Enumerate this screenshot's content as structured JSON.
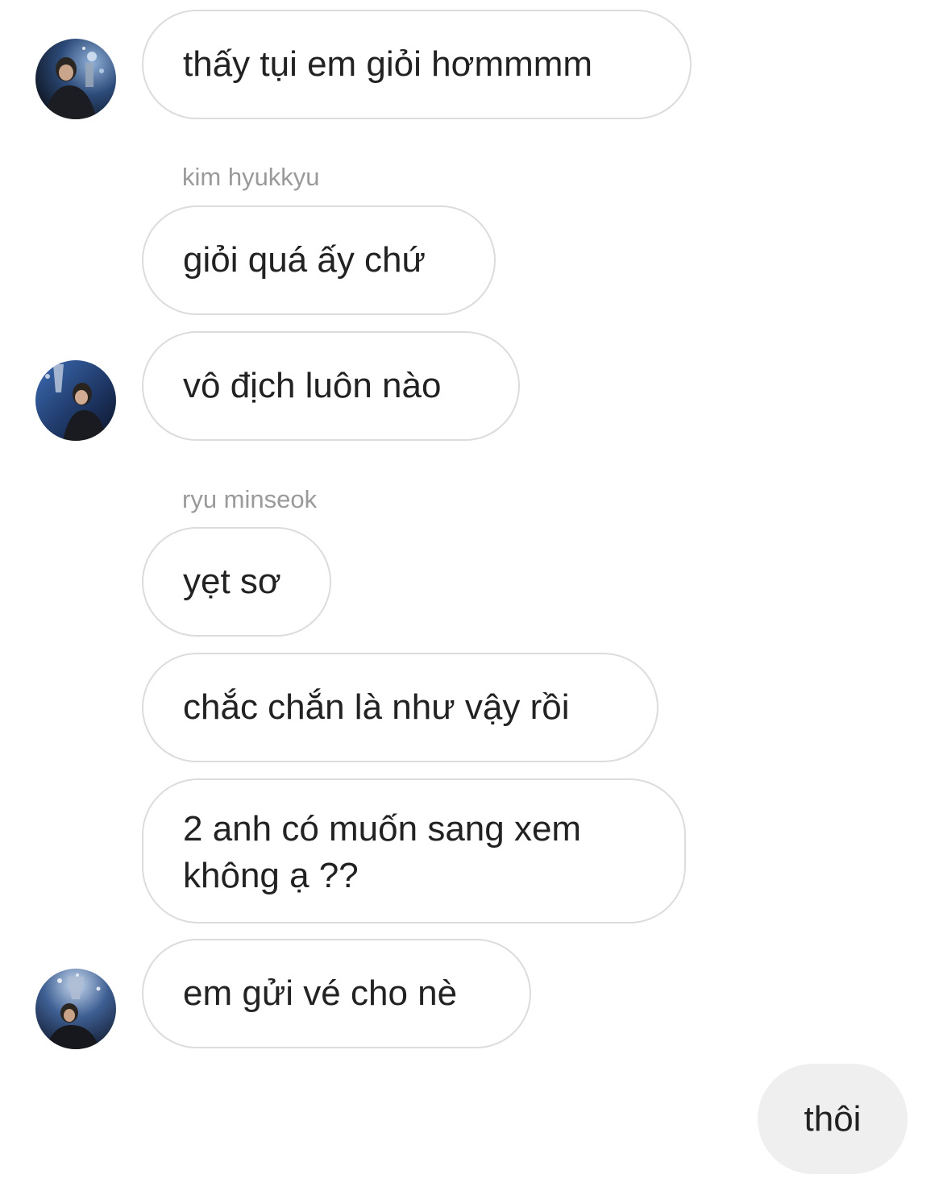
{
  "messages": [
    {
      "text": "thấy tụi em giỏi hơmmmm"
    },
    {
      "sender": "kim hyukkyu",
      "text": "giỏi quá ấy chứ"
    },
    {
      "text": "vô địch luôn nào"
    },
    {
      "sender": "ryu minseok",
      "text": "yẹt sơ"
    },
    {
      "text": "chắc chắn là như vậy rồi"
    },
    {
      "text": "2 anh có muốn sang xem không ạ ??"
    },
    {
      "text": "em gửi vé cho nè"
    },
    {
      "text": "thôi",
      "mine": true
    }
  ],
  "colors": {
    "bubble_border": "#dcdcdc",
    "mine_bubble": "#efefef",
    "sender_name": "#9a9a9a",
    "text": "#222222"
  },
  "avatars": [
    "profile-photo-icon",
    "profile-photo-icon",
    "profile-photo-icon"
  ]
}
